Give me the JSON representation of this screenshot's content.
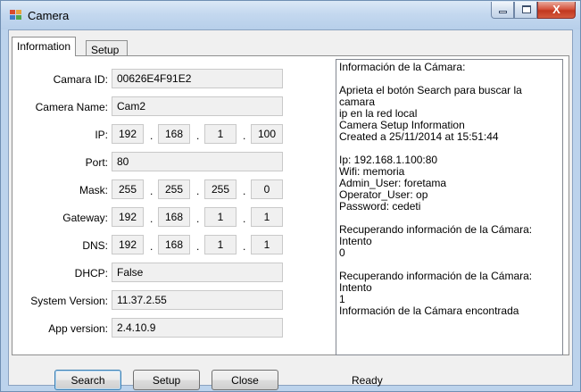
{
  "window": {
    "title": "Camera",
    "icon": "app-window-icon",
    "controls": {
      "minimize": "minimize-icon",
      "maximize": "maximize-icon",
      "close": "close-icon",
      "close_glyph": "X"
    }
  },
  "tabs": [
    {
      "label": "Information",
      "active": true
    },
    {
      "label": "Setup",
      "active": false
    }
  ],
  "form": {
    "camera_id": {
      "label": "Camara ID:",
      "value": "00626E4F91E2"
    },
    "camera_name": {
      "label": "Camera Name:",
      "value": "Cam2"
    },
    "ip": {
      "label": "IP:",
      "octets": [
        "192",
        "168",
        "1",
        "100"
      ]
    },
    "port": {
      "label": "Port:",
      "value": "80"
    },
    "mask": {
      "label": "Mask:",
      "octets": [
        "255",
        "255",
        "255",
        "0"
      ]
    },
    "gateway": {
      "label": "Gateway:",
      "octets": [
        "192",
        "168",
        "1",
        "1"
      ]
    },
    "dns": {
      "label": "DNS:",
      "octets": [
        "192",
        "168",
        "1",
        "1"
      ]
    },
    "dhcp": {
      "label": "DHCP:",
      "value": "False"
    },
    "system_version": {
      "label": "System Version:",
      "value": "11.37.2.55"
    },
    "app_version": {
      "label": "App version:",
      "value": "2.4.10.9"
    },
    "separator": "."
  },
  "log_text": "Información de la Cámara:\n\nAprieta el botón Search para buscar la camara\nip en la red local\nCamera Setup Information\nCreated a 25/11/2014 at 15:51:44\n\nIp: 192.168.1.100:80\nWifi: memoria\nAdmin_User: foretama\nOperator_User: op\nPassword: cedeti\n\nRecuperando información de la Cámara: Intento\n0\n\nRecuperando información de la Cámara: Intento\n1\nInformación de la Cámara encontrada",
  "buttons": {
    "search": "Search",
    "setup": "Setup",
    "close": "Close"
  },
  "status": "Ready",
  "colors": {
    "title_gradient_top": "#dbe8f6",
    "close_button": "#c2371f",
    "field_background": "#f0f0f0",
    "default_button_border": "#3c7fb1"
  }
}
